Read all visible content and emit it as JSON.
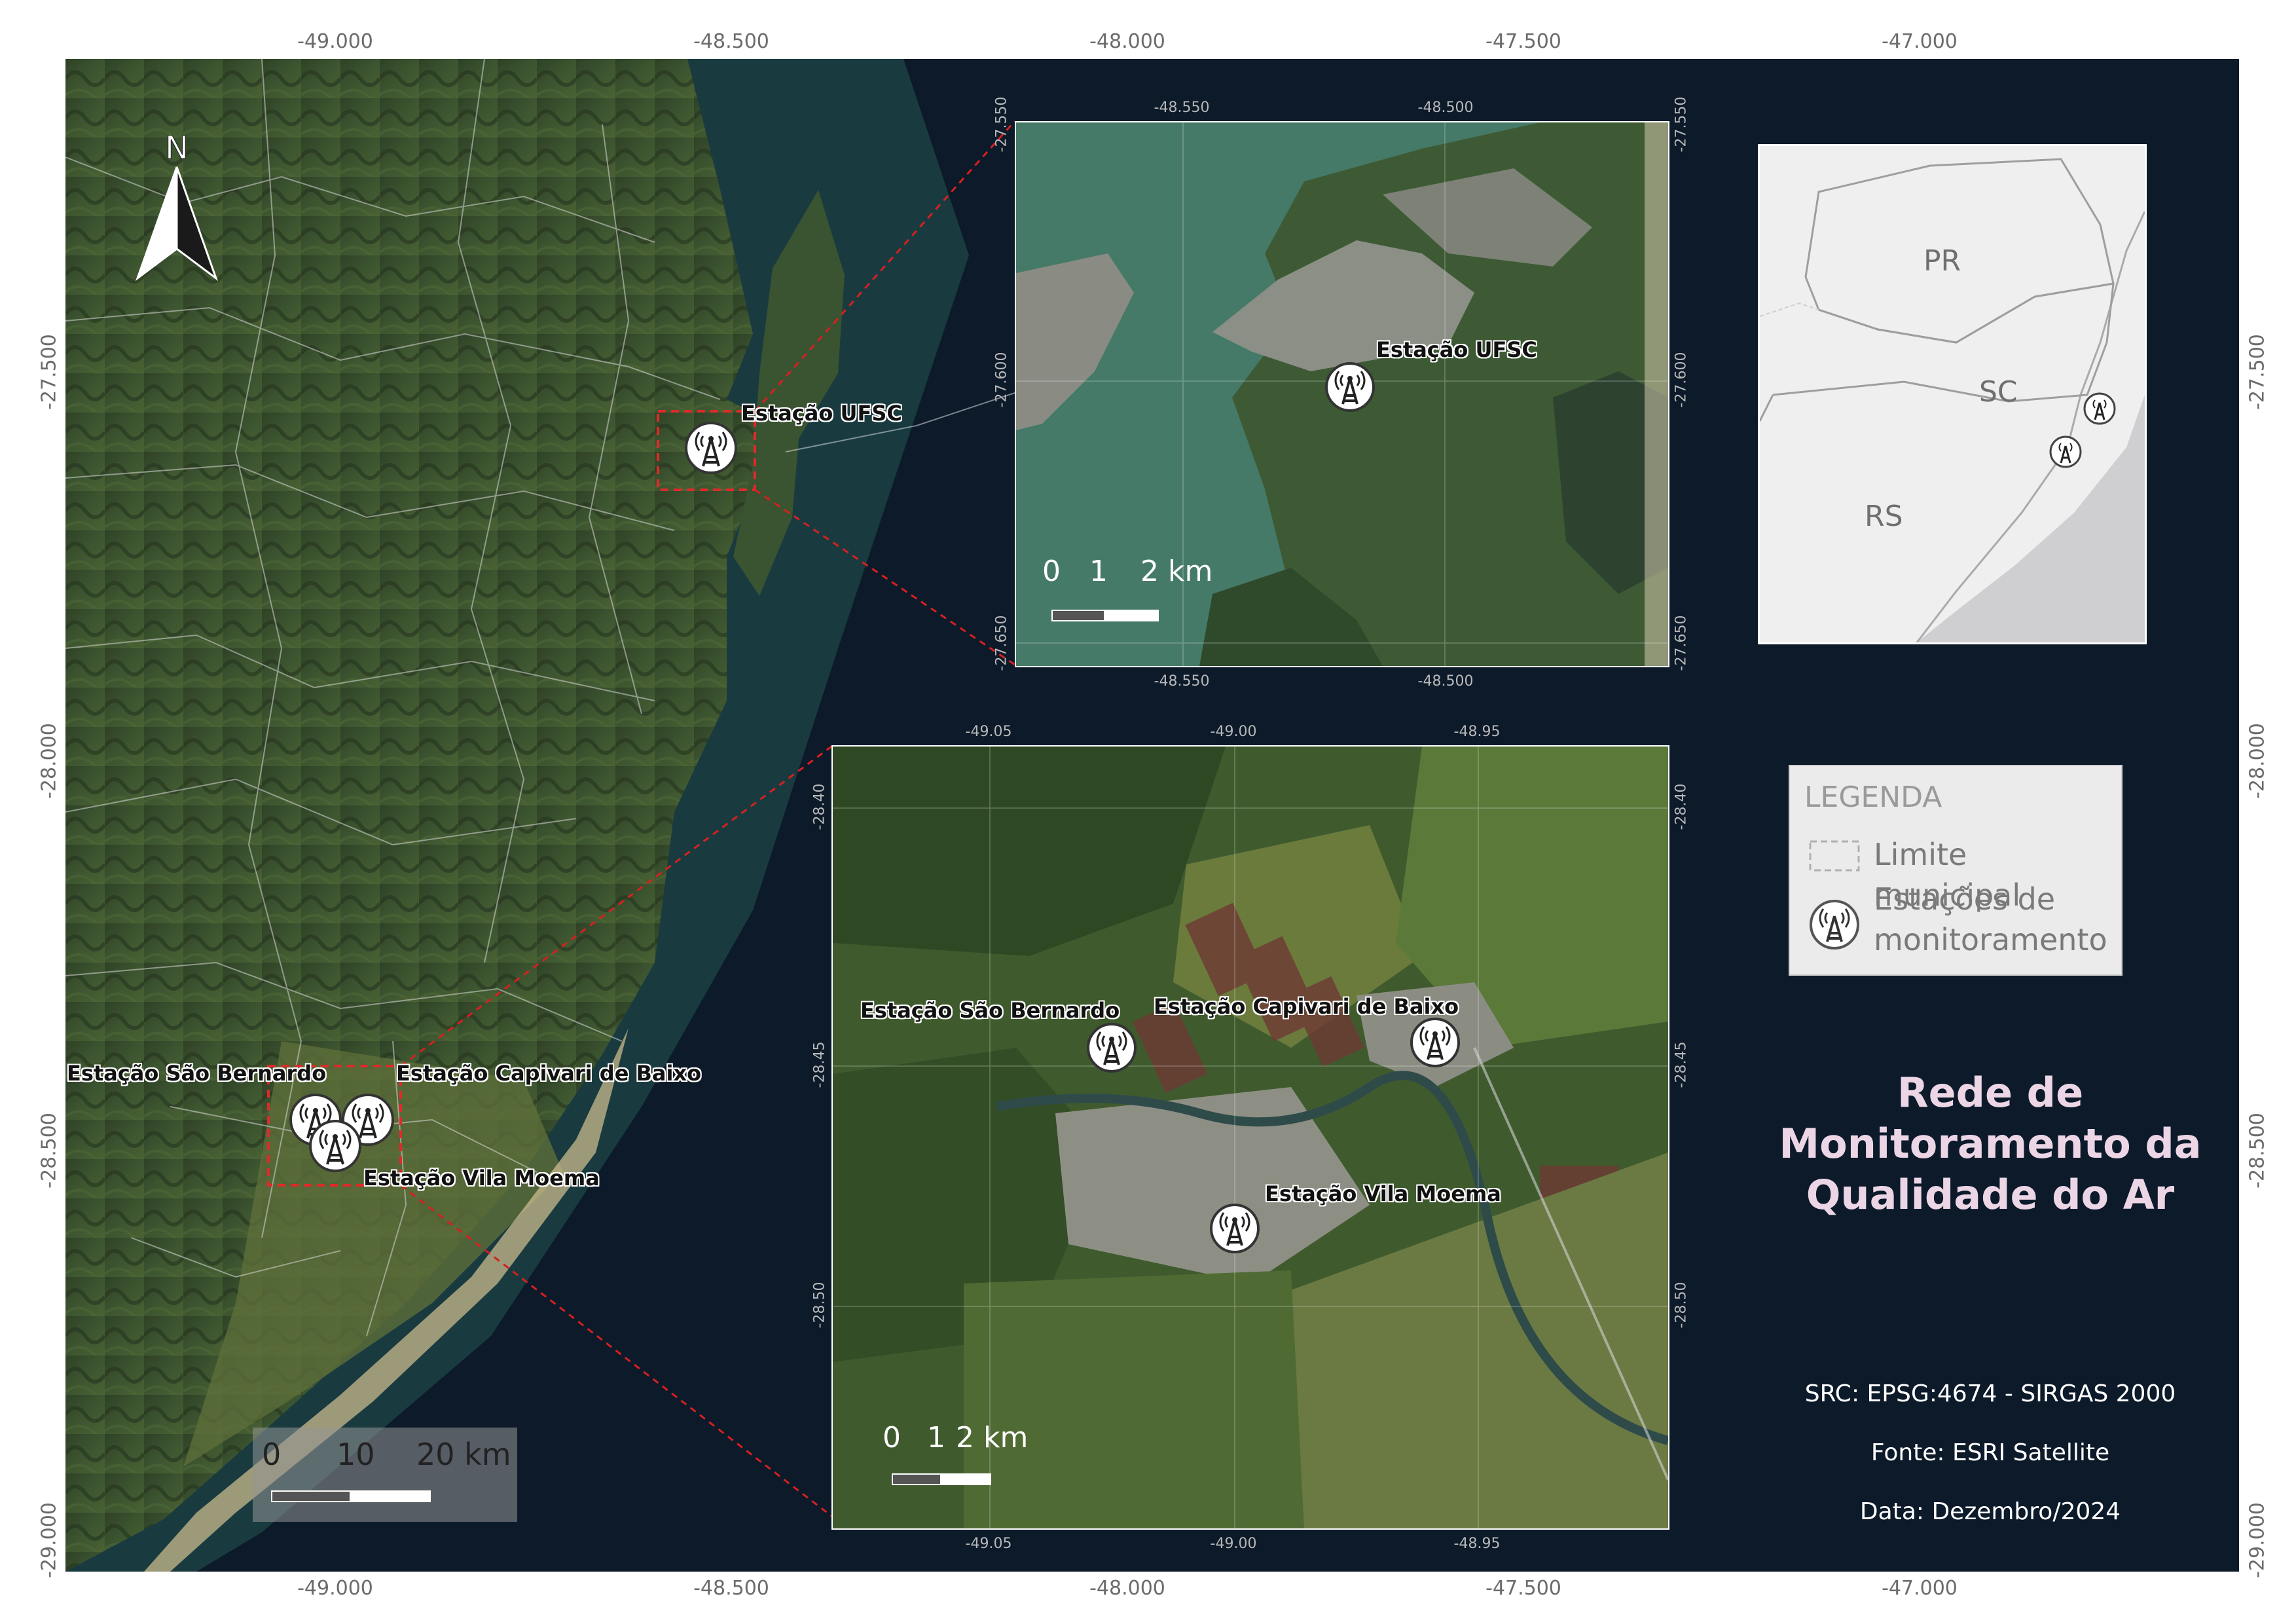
{
  "main_map": {
    "top_lon_labels": [
      "-49.000",
      "-48.500",
      "-48.000",
      "-47.500",
      "-47.000"
    ],
    "bottom_lon_labels": [
      "-49.000",
      "-48.500",
      "-48.000",
      "-47.500",
      "-47.000"
    ],
    "lat_labels": [
      "-27.500",
      "-28.000",
      "-28.500",
      "-29.000"
    ],
    "stations": [
      {
        "name": "Estação UFSC"
      },
      {
        "name": "Estação São Bernardo"
      },
      {
        "name": "Estação Capivari de Baixo"
      },
      {
        "name": "Estação Vila Moema"
      }
    ],
    "scale_bar": {
      "labels": [
        "0",
        "10",
        "20 km"
      ]
    }
  },
  "north_arrow": {
    "label": "N"
  },
  "inset_ufsc": {
    "lon_labels": [
      "-48.550",
      "-48.500"
    ],
    "lat_labels": [
      "-27.550",
      "-27.600",
      "-27.650"
    ],
    "station": "Estação UFSC",
    "scale_bar": {
      "labels": [
        "0",
        "1",
        "2 km"
      ]
    }
  },
  "inset_tubarao": {
    "lon_labels": [
      "-49.05",
      "-49.00",
      "-48.95"
    ],
    "lat_labels": [
      "-28.40",
      "-28.45",
      "-28.50"
    ],
    "stations": [
      "Estação São Bernardo",
      "Estação Capivari de Baixo",
      "Estação Vila Moema"
    ],
    "scale_bar": {
      "labels": [
        "0",
        "1",
        "2 km"
      ]
    }
  },
  "locator_map": {
    "states": [
      "PR",
      "SC",
      "RS"
    ]
  },
  "legend": {
    "title": "LEGENDA",
    "items": [
      {
        "label": "Limite municipal",
        "icon": "dashed-box-icon"
      },
      {
        "label": "Estações de monitoramento",
        "icon": "antenna-tower-icon"
      }
    ]
  },
  "title": "Rede de Monitoramento da Qualidade do Ar",
  "info": {
    "crs": "SRC: EPSG:4674 - SIRGAS 2000",
    "source": "Fonte: ESRI Satellite",
    "date": "Data: Dezembro/2024"
  },
  "colors": {
    "ocean": "#0c1a2a",
    "land_dark": "#2d3f24",
    "land_green": "#3f5a2c",
    "connector": "#d62020",
    "title": "#ecd6e6"
  }
}
